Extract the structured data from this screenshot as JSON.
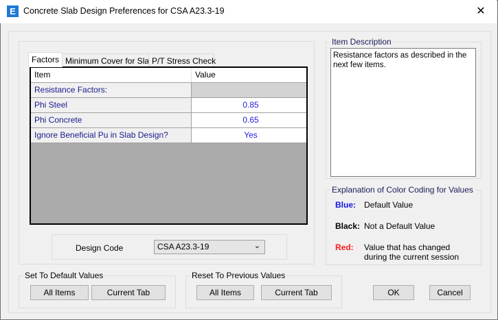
{
  "window": {
    "title": "Concrete Slab Design Preferences for CSA A23.3-19",
    "app_icon": "E",
    "close": "✕"
  },
  "tabs": [
    {
      "label": "Factors",
      "active": true
    },
    {
      "label": "Minimum Cover for Slabs"
    },
    {
      "label": "P/T Stress Check"
    }
  ],
  "grid": {
    "headers": [
      "Item",
      "Value"
    ],
    "rows": [
      {
        "item": "Resistance Factors:",
        "value": ""
      },
      {
        "item": "Phi Steel",
        "value": "0.85"
      },
      {
        "item": "Phi Concrete",
        "value": "0.65"
      },
      {
        "item": "Ignore Beneficial Pu in Slab Design?",
        "value": "Yes"
      }
    ]
  },
  "design_code": {
    "label": "Design Code",
    "value": "CSA A23.3-19"
  },
  "item_description": {
    "title": "Item Description",
    "text": "Resistance factors as described in the next few items."
  },
  "color_coding": {
    "title": "Explanation of Color Coding for Values",
    "entries": [
      {
        "key": "Blue:",
        "desc": "Default Value",
        "color": "#1515e6"
      },
      {
        "key": "Black:",
        "desc": "Not a Default Value",
        "color": "#000000"
      },
      {
        "key": "Red:",
        "desc": "Value that has changed during the current session",
        "color": "#ff1a1a"
      }
    ]
  },
  "set_default": {
    "title": "Set To Default Values",
    "all": "All Items",
    "current": "Current Tab"
  },
  "reset_previous": {
    "title": "Reset To Previous Values",
    "all": "All Items",
    "current": "Current Tab"
  },
  "ok": "OK",
  "cancel": "Cancel"
}
